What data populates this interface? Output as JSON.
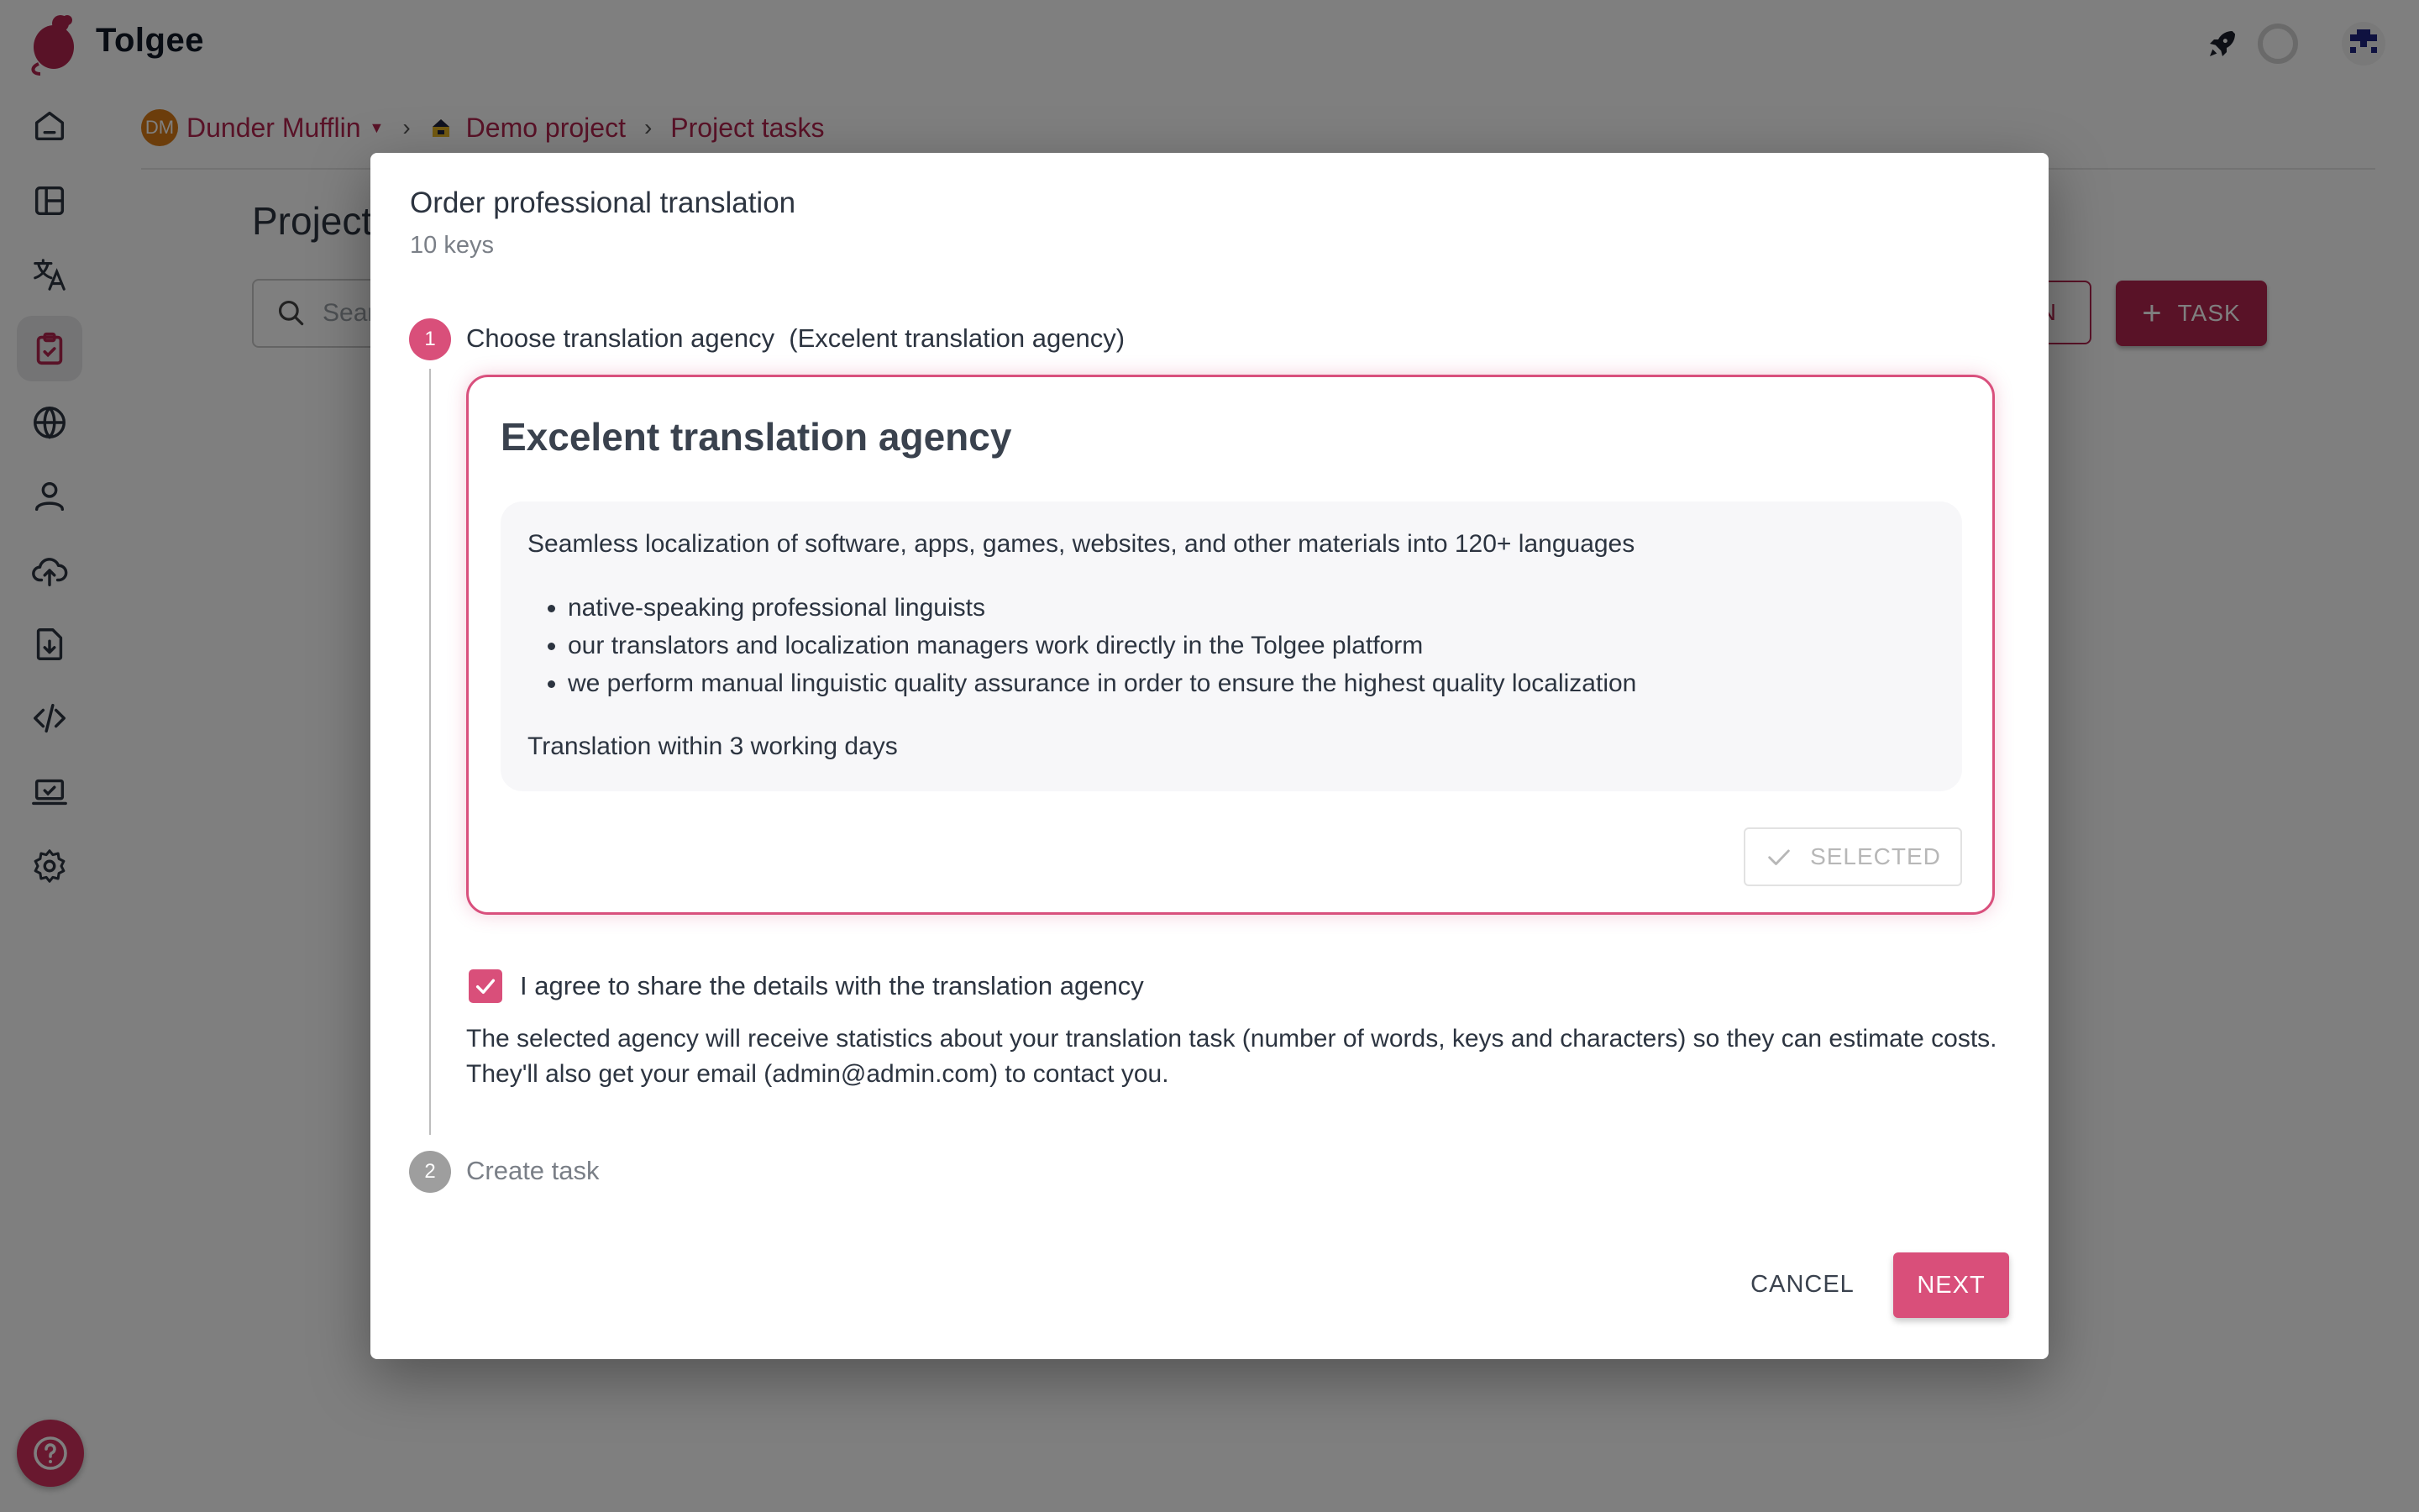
{
  "app": {
    "brand": "Tolgee",
    "colors": {
      "primary": "#b3244f",
      "accent": "#d94f7a",
      "text": "#2c3440",
      "muted": "#7a7f87"
    }
  },
  "topbar": {
    "icons": [
      "rocket-icon",
      "loading-spinner-icon",
      "user-avatar-icon"
    ]
  },
  "sidebar": {
    "items": [
      {
        "name": "projects",
        "icon": "home-icon"
      },
      {
        "name": "dashboard",
        "icon": "layout-icon"
      },
      {
        "name": "translations",
        "icon": "translate-icon"
      },
      {
        "name": "tasks",
        "icon": "clipboard-check-icon",
        "active": true
      },
      {
        "name": "languages",
        "icon": "globe-icon"
      },
      {
        "name": "members",
        "icon": "user-icon"
      },
      {
        "name": "import",
        "icon": "cloud-upload-icon"
      },
      {
        "name": "export",
        "icon": "file-download-icon"
      },
      {
        "name": "developer",
        "icon": "code-icon"
      },
      {
        "name": "integrate",
        "icon": "laptop-check-icon"
      },
      {
        "name": "settings",
        "icon": "gear-icon"
      }
    ],
    "help_icon": "help-circle-icon"
  },
  "breadcrumb": {
    "org_initials": "DM",
    "org": "Dunder Mufflin",
    "project": "Demo project",
    "page": "Project tasks"
  },
  "page": {
    "title": "Project tasks",
    "search_placeholder": "Search",
    "secondary_button": "N",
    "add_task_button": "TASK"
  },
  "modal": {
    "title": "Order professional translation",
    "subtitle": "10 keys",
    "steps": [
      {
        "number": "1",
        "label": "Choose translation agency  (Excelent translation agency)",
        "state": "active"
      },
      {
        "number": "2",
        "label": "Create task",
        "state": "inactive"
      }
    ],
    "agency": {
      "name": "Excelent translation agency",
      "description": "Seamless localization of software, apps, games, websites, and other materials into 120+ languages",
      "features": [
        "native-speaking professional linguists",
        "our translators and localization managers work directly in the Tolgee platform",
        "we perform manual linguistic quality assurance in order to ensure the highest quality localization"
      ],
      "turnaround": "Translation within 3 working days",
      "selected_label": "SELECTED",
      "selected": true
    },
    "consent": {
      "checked": true,
      "label": "I agree to share the details with the translation agency",
      "details": "The selected agency will receive statistics about your translation task (number of words, keys and characters) so they can estimate costs. They'll also get your email (admin@admin.com) to contact you."
    },
    "actions": {
      "cancel": "CANCEL",
      "next": "NEXT"
    }
  }
}
